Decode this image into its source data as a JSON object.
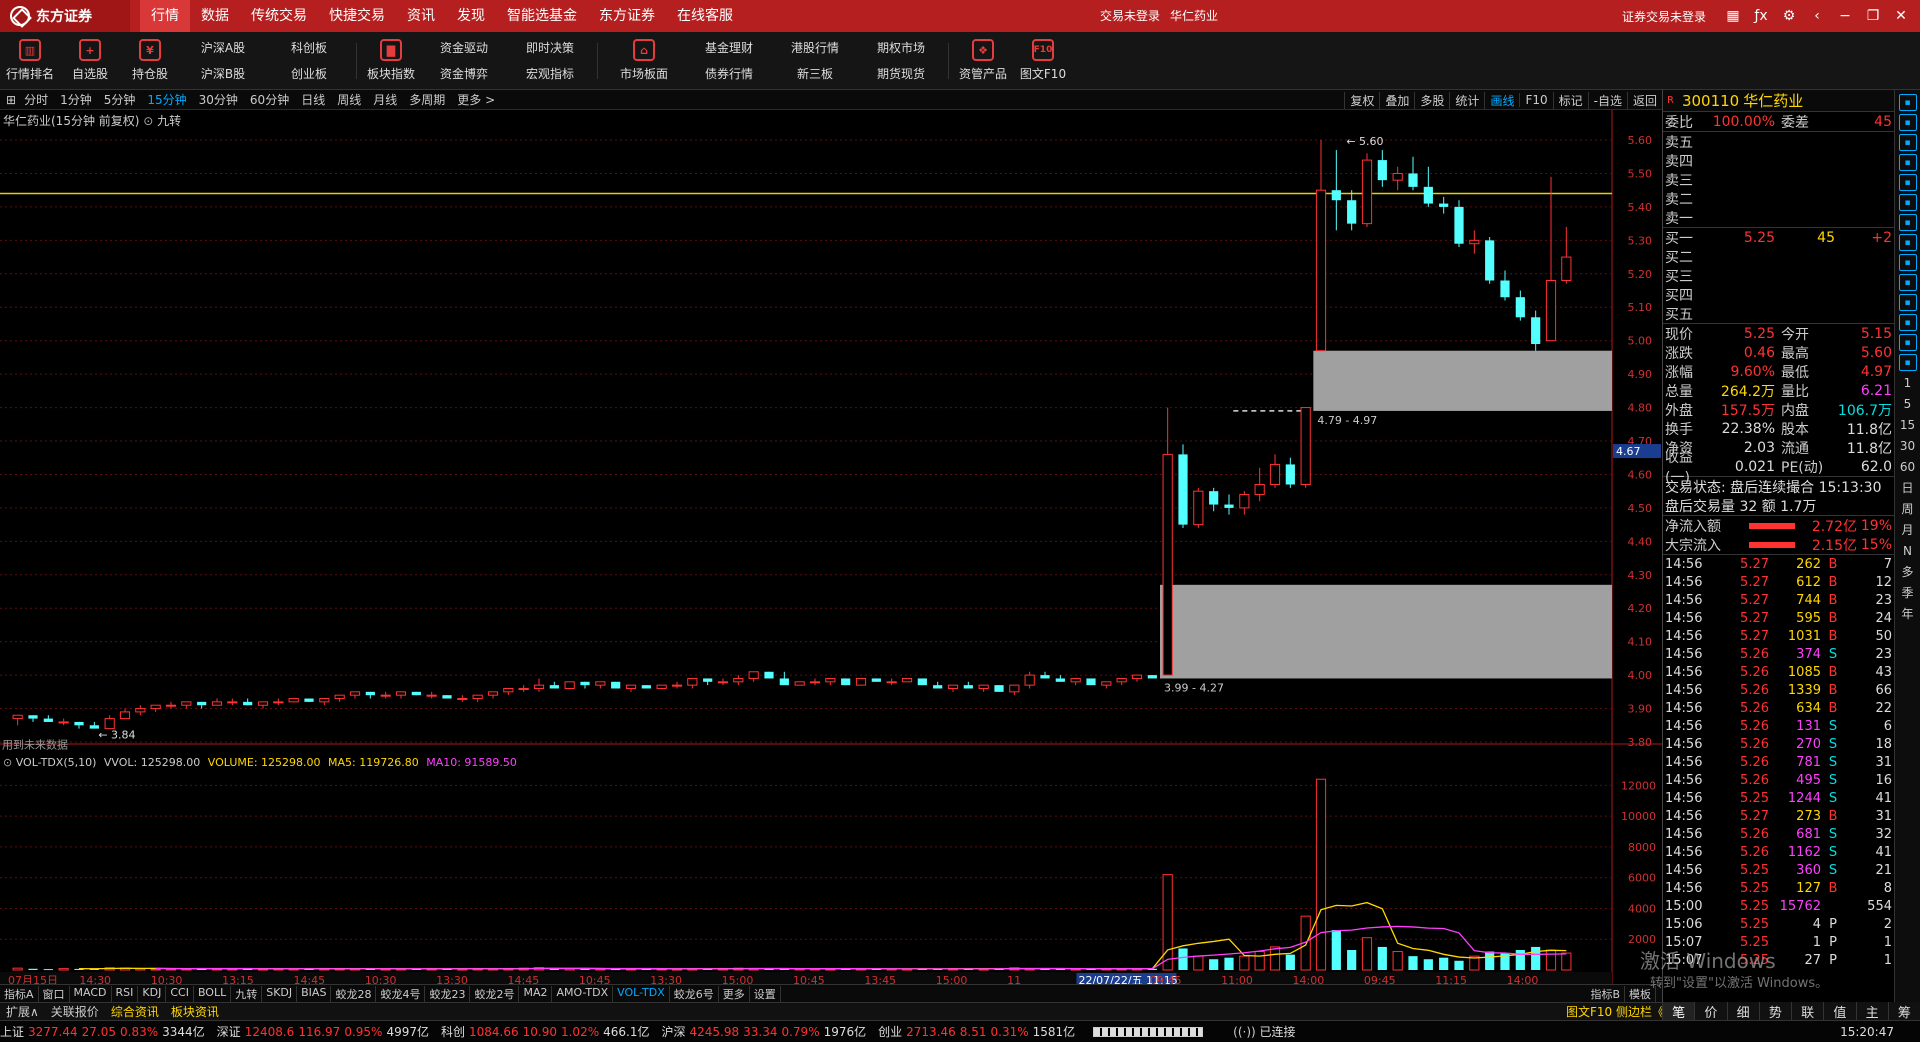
{
  "titlebar": {
    "logo_text": "东方证券",
    "menu": [
      "行情",
      "数据",
      "传统交易",
      "快捷交易",
      "资讯",
      "发现",
      "智能选基金",
      "东方证券",
      "在线客服"
    ],
    "login_tip": "交易未登录",
    "stock_name": "华仁药业",
    "right_text": "证券交易未登录"
  },
  "toolbar": {
    "tools": [
      "行情排名",
      "自选股",
      "持仓股"
    ],
    "pairs": [
      [
        "沪深A股",
        "沪深B股"
      ],
      [
        "科创板",
        "创业板"
      ]
    ],
    "tool2": "板块指数",
    "pairs2": [
      [
        "资金驱动",
        "资金博弈"
      ],
      [
        "即时决策",
        "宏观指标"
      ]
    ],
    "tool3": "市场板面",
    "pairs3": [
      [
        "基金理财",
        "债券行情"
      ],
      [
        "港股行情",
        "新三板"
      ],
      [
        "期权市场",
        "期货现货"
      ]
    ],
    "tool4": "资管产品",
    "tool5": "图文F10",
    "tool5_icon": "F10"
  },
  "periods": {
    "items": [
      "分时",
      "1分钟",
      "5分钟",
      "15分钟",
      "30分钟",
      "60分钟",
      "日线",
      "周线",
      "月线",
      "多周期",
      "更多 >"
    ],
    "active_index": 3,
    "tools": [
      "复权",
      "叠加",
      "多股",
      "统计",
      "画线",
      "F10",
      "标记",
      "-自选",
      "返回"
    ],
    "active_tool": 4
  },
  "chart_header": {
    "title": "华仁药业(15分钟 前复权)",
    "indicator": "九转",
    "future_note": "用到未来数据"
  },
  "vol_header": {
    "name": "VOL-TDX(5,10)",
    "vol": "VVOL: 125298.00",
    "volume": "VOLUME: 125298.00",
    "ma5": "MA5: 119726.80",
    "ma10": "MA10: 91589.50"
  },
  "chart_data": {
    "type": "candlestick",
    "price_axis": {
      "min": 3.8,
      "max": 5.6,
      "ticks": [
        "5.60",
        "5.50",
        "5.40",
        "5.30",
        "5.20",
        "5.10",
        "5.00",
        "4.90",
        "4.80",
        "4.70",
        "4.60",
        "4.50",
        "4.40",
        "4.30",
        "4.20",
        "4.10",
        "4.00",
        "3.90",
        "3.80"
      ]
    },
    "current_price_label": "4.67",
    "reference_line": 5.44,
    "annotations": [
      {
        "text": "5.60",
        "price": 5.6
      },
      {
        "text": "3.84",
        "price": 3.84
      }
    ],
    "gaps": [
      {
        "label": "3.99 - 4.27",
        "low": 3.99,
        "high": 4.27
      },
      {
        "label": "4.79 - 4.97",
        "low": 4.79,
        "high": 4.97
      }
    ],
    "candles": [
      [
        3.87,
        3.88,
        3.85,
        3.88
      ],
      [
        3.88,
        3.88,
        3.86,
        3.87
      ],
      [
        3.87,
        3.88,
        3.86,
        3.86
      ],
      [
        3.86,
        3.87,
        3.85,
        3.86
      ],
      [
        3.86,
        3.86,
        3.84,
        3.85
      ],
      [
        3.85,
        3.86,
        3.84,
        3.84
      ],
      [
        3.84,
        3.88,
        3.84,
        3.87
      ],
      [
        3.87,
        3.9,
        3.87,
        3.89
      ],
      [
        3.89,
        3.91,
        3.88,
        3.9
      ],
      [
        3.9,
        3.91,
        3.89,
        3.91
      ],
      [
        3.91,
        3.92,
        3.9,
        3.91
      ],
      [
        3.91,
        3.92,
        3.9,
        3.92
      ],
      [
        3.92,
        3.92,
        3.9,
        3.91
      ],
      [
        3.91,
        3.93,
        3.91,
        3.92
      ],
      [
        3.92,
        3.93,
        3.91,
        3.92
      ],
      [
        3.92,
        3.93,
        3.91,
        3.91
      ],
      [
        3.91,
        3.92,
        3.9,
        3.92
      ],
      [
        3.92,
        3.93,
        3.91,
        3.92
      ],
      [
        3.92,
        3.93,
        3.92,
        3.93
      ],
      [
        3.93,
        3.93,
        3.92,
        3.92
      ],
      [
        3.92,
        3.93,
        3.91,
        3.93
      ],
      [
        3.93,
        3.94,
        3.92,
        3.94
      ],
      [
        3.94,
        3.95,
        3.93,
        3.95
      ],
      [
        3.95,
        3.95,
        3.93,
        3.94
      ],
      [
        3.94,
        3.95,
        3.93,
        3.94
      ],
      [
        3.94,
        3.95,
        3.93,
        3.95
      ],
      [
        3.95,
        3.95,
        3.94,
        3.94
      ],
      [
        3.94,
        3.95,
        3.93,
        3.94
      ],
      [
        3.94,
        3.94,
        3.93,
        3.93
      ],
      [
        3.93,
        3.94,
        3.92,
        3.93
      ],
      [
        3.93,
        3.94,
        3.92,
        3.94
      ],
      [
        3.94,
        3.95,
        3.93,
        3.95
      ],
      [
        3.95,
        3.96,
        3.94,
        3.96
      ],
      [
        3.96,
        3.97,
        3.95,
        3.96
      ],
      [
        3.96,
        3.99,
        3.95,
        3.97
      ],
      [
        3.97,
        3.98,
        3.96,
        3.96
      ],
      [
        3.96,
        3.98,
        3.96,
        3.98
      ],
      [
        3.98,
        3.98,
        3.96,
        3.97
      ],
      [
        3.97,
        3.98,
        3.96,
        3.98
      ],
      [
        3.98,
        3.98,
        3.96,
        3.96
      ],
      [
        3.96,
        3.97,
        3.95,
        3.97
      ],
      [
        3.97,
        3.97,
        3.96,
        3.96
      ],
      [
        3.96,
        3.97,
        3.96,
        3.97
      ],
      [
        3.97,
        3.98,
        3.96,
        3.97
      ],
      [
        3.97,
        3.99,
        3.96,
        3.99
      ],
      [
        3.99,
        3.99,
        3.97,
        3.98
      ],
      [
        3.98,
        3.99,
        3.97,
        3.98
      ],
      [
        3.98,
        4.0,
        3.97,
        3.99
      ],
      [
        3.99,
        4.01,
        3.98,
        4.01
      ],
      [
        4.01,
        4.01,
        3.99,
        3.99
      ],
      [
        3.99,
        4.01,
        3.98,
        3.97
      ],
      [
        3.97,
        3.98,
        3.97,
        3.98
      ],
      [
        3.98,
        3.99,
        3.97,
        3.98
      ],
      [
        3.98,
        3.99,
        3.97,
        3.99
      ],
      [
        3.99,
        3.99,
        3.97,
        3.97
      ],
      [
        3.97,
        3.99,
        3.97,
        3.99
      ],
      [
        3.99,
        3.99,
        3.98,
        3.98
      ],
      [
        3.98,
        3.99,
        3.97,
        3.98
      ],
      [
        3.98,
        3.99,
        3.98,
        3.99
      ],
      [
        3.99,
        3.99,
        3.97,
        3.97
      ],
      [
        3.97,
        3.98,
        3.96,
        3.96
      ],
      [
        3.96,
        3.97,
        3.95,
        3.97
      ],
      [
        3.97,
        3.98,
        3.96,
        3.96
      ],
      [
        3.96,
        3.97,
        3.95,
        3.97
      ],
      [
        3.97,
        3.97,
        3.95,
        3.95
      ],
      [
        3.95,
        3.97,
        3.94,
        3.97
      ],
      [
        3.97,
        4.01,
        3.96,
        4.0
      ],
      [
        4.0,
        4.01,
        3.99,
        3.99
      ],
      [
        3.99,
        4.0,
        3.98,
        3.98
      ],
      [
        3.98,
        3.99,
        3.97,
        3.99
      ],
      [
        3.99,
        3.99,
        3.97,
        3.97
      ],
      [
        3.97,
        3.98,
        3.96,
        3.98
      ],
      [
        3.98,
        3.99,
        3.97,
        3.99
      ],
      [
        3.99,
        4.0,
        3.98,
        4.0
      ],
      [
        4.0,
        4.0,
        3.99,
        3.99
      ],
      [
        4.0,
        4.8,
        4.27,
        4.66
      ],
      [
        4.66,
        4.69,
        4.44,
        4.45
      ],
      [
        4.45,
        4.56,
        4.44,
        4.55
      ],
      [
        4.55,
        4.56,
        4.49,
        4.51
      ],
      [
        4.51,
        4.54,
        4.48,
        4.5
      ],
      [
        4.5,
        4.55,
        4.48,
        4.54
      ],
      [
        4.54,
        4.62,
        4.52,
        4.57
      ],
      [
        4.57,
        4.66,
        4.56,
        4.63
      ],
      [
        4.63,
        4.65,
        4.56,
        4.57
      ],
      [
        4.57,
        4.8,
        4.56,
        4.8
      ],
      [
        4.97,
        5.6,
        5.05,
        5.45
      ],
      [
        5.45,
        5.57,
        5.33,
        5.42
      ],
      [
        5.42,
        5.45,
        5.33,
        5.35
      ],
      [
        5.35,
        5.56,
        5.34,
        5.54
      ],
      [
        5.54,
        5.57,
        5.46,
        5.48
      ],
      [
        5.48,
        5.52,
        5.45,
        5.5
      ],
      [
        5.5,
        5.55,
        5.45,
        5.46
      ],
      [
        5.46,
        5.52,
        5.4,
        5.41
      ],
      [
        5.41,
        5.43,
        5.38,
        5.4
      ],
      [
        5.4,
        5.42,
        5.28,
        5.29
      ],
      [
        5.29,
        5.33,
        5.26,
        5.3
      ],
      [
        5.3,
        5.31,
        5.17,
        5.18
      ],
      [
        5.18,
        5.21,
        5.12,
        5.13
      ],
      [
        5.13,
        5.15,
        5.06,
        5.07
      ],
      [
        5.07,
        5.09,
        4.97,
        4.99
      ],
      [
        5.0,
        5.49,
        5.01,
        5.18
      ],
      [
        5.18,
        5.34,
        5.17,
        5.25
      ]
    ],
    "volume_axis": {
      "ticks": [
        "12000",
        "10000",
        "8000",
        "6000",
        "4000",
        "2000"
      ],
      "max": 13000
    },
    "volumes": [
      120,
      80,
      60,
      90,
      70,
      110,
      150,
      130,
      80,
      60,
      70,
      90,
      100,
      80,
      70,
      90,
      60,
      80,
      70,
      90,
      100,
      80,
      90,
      70,
      60,
      80,
      70,
      90,
      80,
      60,
      90,
      80,
      100,
      120,
      150,
      80,
      90,
      70,
      80,
      60,
      90,
      80,
      70,
      60,
      80,
      90,
      100,
      120,
      90,
      80,
      70,
      90,
      80,
      60,
      70,
      80,
      90,
      70,
      60,
      80,
      70,
      90,
      80,
      60,
      100,
      140,
      90,
      70,
      80,
      60,
      90,
      70,
      80,
      100,
      80,
      6200,
      1400,
      900,
      700,
      800,
      900,
      1200,
      1500,
      1000,
      3500,
      12400,
      2600,
      1300,
      2100,
      1500,
      1200,
      900,
      700,
      800,
      600,
      900,
      1200,
      1100,
      1300,
      1500,
      1300,
      1100
    ],
    "x_ticks": [
      "07月15日",
      "14:30",
      "10:30",
      "13:15",
      "14:45",
      "10:30",
      "13:30",
      "14:45",
      "10:45",
      "13:30",
      "15:00",
      "10:45",
      "13:45",
      "15:00",
      "11",
      "22/07/22/五 11:15",
      "09:45",
      "11:00",
      "14:00",
      "09:45",
      "11:15",
      "14:00"
    ]
  },
  "indicators": [
    "指标A",
    "窗口",
    "MACD",
    "RSI",
    "KDJ",
    "CCI",
    "BOLL",
    "九转",
    "SKDJ",
    "BIAS",
    "蛟龙28",
    "蛟龙4号",
    "蛟龙23",
    "蛟龙2号",
    "MA2",
    "AMO-TDX",
    "VOL-TDX",
    "蛟龙6号",
    "更多",
    "设置"
  ],
  "indicators_active": 16,
  "ind_right": [
    "指标B",
    "模板"
  ],
  "tabs": [
    "扩展∧",
    "关联报价",
    "综合资讯",
    "板块资讯"
  ],
  "tabs_right": "图文F10 侧边栏《",
  "status": {
    "sh": [
      "上证",
      "3277.44",
      "27.05",
      "0.83%",
      "3344亿"
    ],
    "sz": [
      "深证",
      "12408.6",
      "116.97",
      "0.95%",
      "4997亿"
    ],
    "kc": [
      "科创",
      "1084.66",
      "10.90",
      "1.02%",
      "466.1亿"
    ],
    "hs": [
      "沪深",
      "4245.98",
      "33.34",
      "0.79%",
      "1976亿"
    ],
    "cy": [
      "创业",
      "2713.46",
      "8.51",
      "0.31%",
      "1581亿"
    ],
    "conn": "已连接",
    "time": "15:20:47"
  },
  "quote": {
    "code": "300110",
    "name": "华仁药业",
    "wb_label": "委比",
    "wb": "100.00%",
    "wc_label": "委差",
    "wc": "45",
    "sell": [
      "卖五",
      "卖四",
      "卖三",
      "卖二",
      "卖一"
    ],
    "buy": [
      [
        "买一",
        "5.25",
        "45",
        "+2"
      ],
      [
        "买二",
        "",
        "",
        ""
      ],
      [
        "买三",
        "",
        "",
        ""
      ],
      [
        "买四",
        "",
        "",
        ""
      ],
      [
        "买五",
        "",
        "",
        ""
      ]
    ],
    "stats": [
      [
        "现价",
        "5.25",
        "今开",
        "5.15"
      ],
      [
        "涨跌",
        "0.46",
        "最高",
        "5.60"
      ],
      [
        "涨幅",
        "9.60%",
        "最低",
        "4.97"
      ],
      [
        "总量",
        "264.2万",
        "量比",
        "6.21"
      ],
      [
        "外盘",
        "157.5万",
        "内盘",
        "106.7万"
      ],
      [
        "换手",
        "22.38%",
        "股本",
        "11.8亿"
      ],
      [
        "净资",
        "2.03",
        "流通",
        "11.8亿"
      ],
      [
        "收益(一)",
        "0.021",
        "PE(动)",
        "62.0"
      ]
    ],
    "trade_status": "交易状态: 盘后连续撮合 15:13:30",
    "after_trade": "盘后交易量 32 额 1.7万",
    "flow": [
      [
        "净流入额",
        "2.72亿",
        "19%"
      ],
      [
        "大宗流入",
        "2.15亿",
        "15%"
      ]
    ],
    "ticks": [
      [
        "14:56",
        "5.27",
        "262",
        "B",
        "7"
      ],
      [
        "14:56",
        "5.27",
        "612",
        "B",
        "12"
      ],
      [
        "14:56",
        "5.27",
        "744",
        "B",
        "23"
      ],
      [
        "14:56",
        "5.27",
        "595",
        "B",
        "24"
      ],
      [
        "14:56",
        "5.27",
        "1031",
        "B",
        "50"
      ],
      [
        "14:56",
        "5.26",
        "374",
        "S",
        "23"
      ],
      [
        "14:56",
        "5.26",
        "1085",
        "B",
        "43"
      ],
      [
        "14:56",
        "5.26",
        "1339",
        "B",
        "66"
      ],
      [
        "14:56",
        "5.26",
        "634",
        "B",
        "22"
      ],
      [
        "14:56",
        "5.26",
        "131",
        "S",
        "6"
      ],
      [
        "14:56",
        "5.26",
        "270",
        "S",
        "18"
      ],
      [
        "14:56",
        "5.26",
        "781",
        "S",
        "31"
      ],
      [
        "14:56",
        "5.26",
        "495",
        "S",
        "16"
      ],
      [
        "14:56",
        "5.25",
        "1244",
        "S",
        "41"
      ],
      [
        "14:56",
        "5.27",
        "273",
        "B",
        "31"
      ],
      [
        "14:56",
        "5.26",
        "681",
        "S",
        "32"
      ],
      [
        "14:56",
        "5.26",
        "1162",
        "S",
        "41"
      ],
      [
        "14:56",
        "5.25",
        "360",
        "S",
        "21"
      ],
      [
        "14:56",
        "5.25",
        "127",
        "B",
        "8"
      ],
      [
        "15:00",
        "5.25",
        "15762",
        "",
        "554"
      ],
      [
        "15:06",
        "5.25",
        "4",
        "P",
        "2"
      ],
      [
        "15:07",
        "5.25",
        "1",
        "P",
        "1"
      ],
      [
        "15:07",
        "5.25",
        "27",
        "P",
        "1"
      ]
    ]
  },
  "sidebar_text": [
    "1",
    "5",
    "15",
    "30",
    "60",
    "日",
    "周",
    "月",
    "N",
    "多",
    "季",
    "年"
  ],
  "rbottom": [
    "笔",
    "价",
    "细",
    "势",
    "联",
    "值",
    "主",
    "筹"
  ],
  "watermark": {
    "line1": "激活 Windows",
    "line2": "转到\"设置\"以激活 Windows。"
  }
}
